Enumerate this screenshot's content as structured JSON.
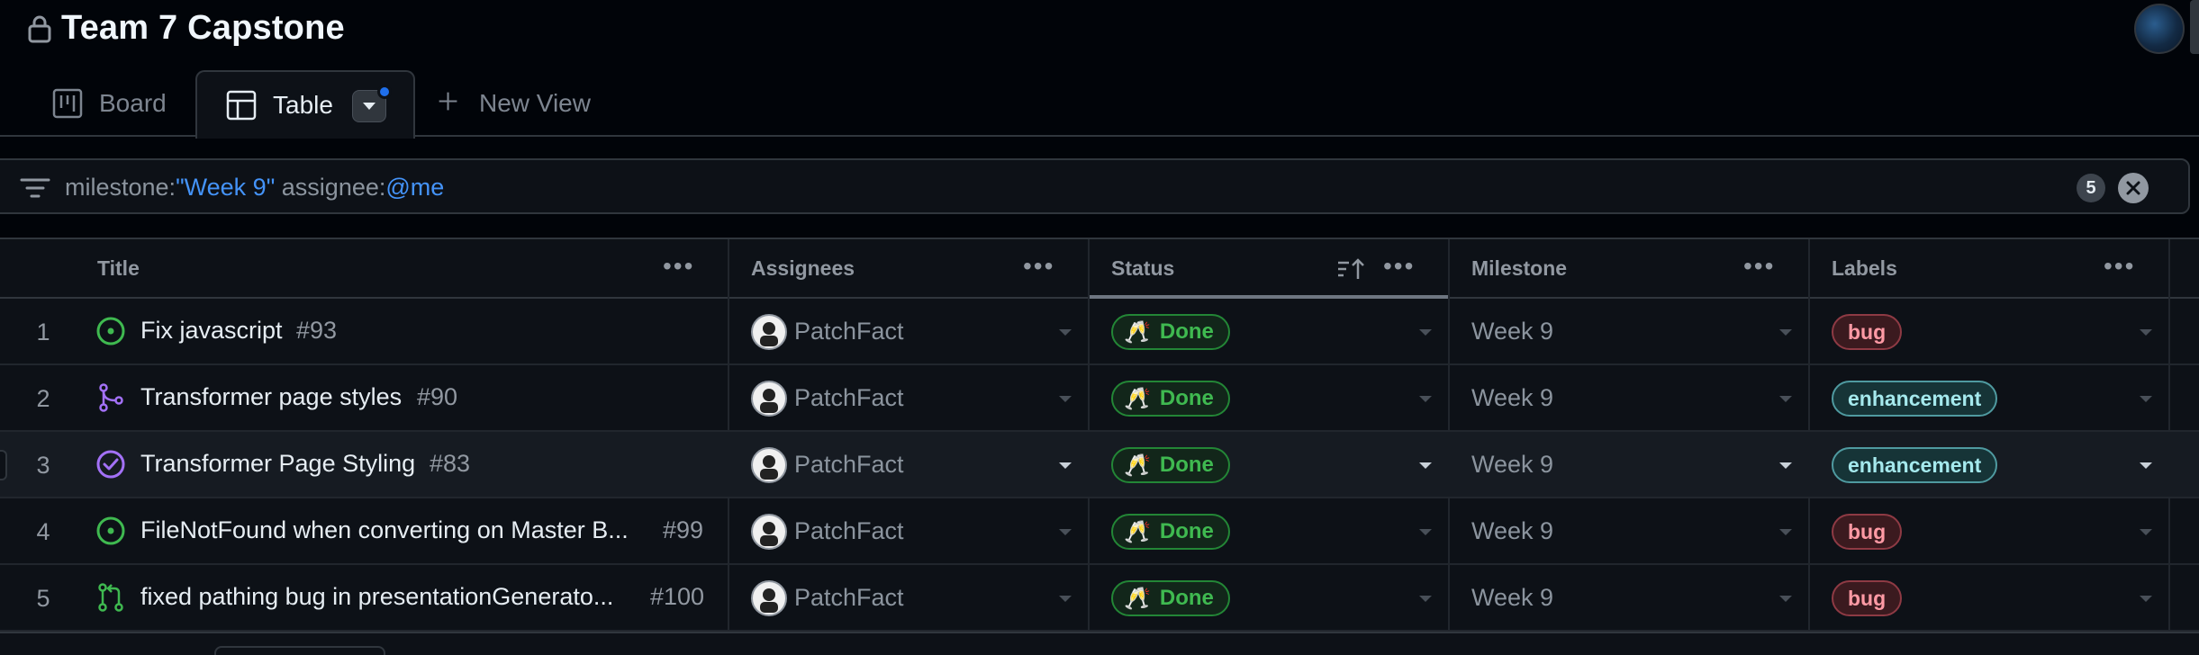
{
  "project": {
    "title": "Team 7 Capstone"
  },
  "tabs": [
    {
      "label": "Board"
    },
    {
      "label": "Table"
    },
    {
      "label": "New View"
    }
  ],
  "filter": {
    "key1": "milestone:",
    "value1": "\"Week 9\"",
    "key2": " assignee:",
    "value2": "@me",
    "count": "5"
  },
  "columns": {
    "title": "Title",
    "assignees": "Assignees",
    "status": "Status",
    "milestone": "Milestone",
    "labels": "Labels"
  },
  "rows": [
    {
      "num": "1",
      "title": "Fix javascript",
      "issue": "#93",
      "icon": "open-issue-icon",
      "assignee": "PatchFact",
      "status": "Done",
      "milestone": "Week 9",
      "label": "bug"
    },
    {
      "num": "2",
      "title": "Transformer page styles",
      "issue": "#90",
      "icon": "merged-pr-icon",
      "assignee": "PatchFact",
      "status": "Done",
      "milestone": "Week 9",
      "label": "enhancement"
    },
    {
      "num": "3",
      "title": "Transformer Page Styling",
      "issue": "#83",
      "icon": "closed-issue-icon",
      "assignee": "PatchFact",
      "status": "Done",
      "milestone": "Week 9",
      "label": "enhancement"
    },
    {
      "num": "4",
      "title": "FileNotFound when converting on Master B...",
      "issue": "#99",
      "icon": "open-issue-icon",
      "assignee": "PatchFact",
      "status": "Done",
      "milestone": "Week 9",
      "label": "bug"
    },
    {
      "num": "5",
      "title": "fixed pathing bug in presentationGenerato...",
      "issue": "#100",
      "icon": "open-pr-icon",
      "assignee": "PatchFact",
      "status": "Done",
      "milestone": "Week 9",
      "label": "bug"
    }
  ],
  "colors": {
    "background": "#010409",
    "accent_blue": "#4493f8",
    "done_green": "#3fb950",
    "bug_label": "#ff9aa5",
    "enhancement_label": "#a5e9ed",
    "merged_purple": "#a371f7"
  }
}
